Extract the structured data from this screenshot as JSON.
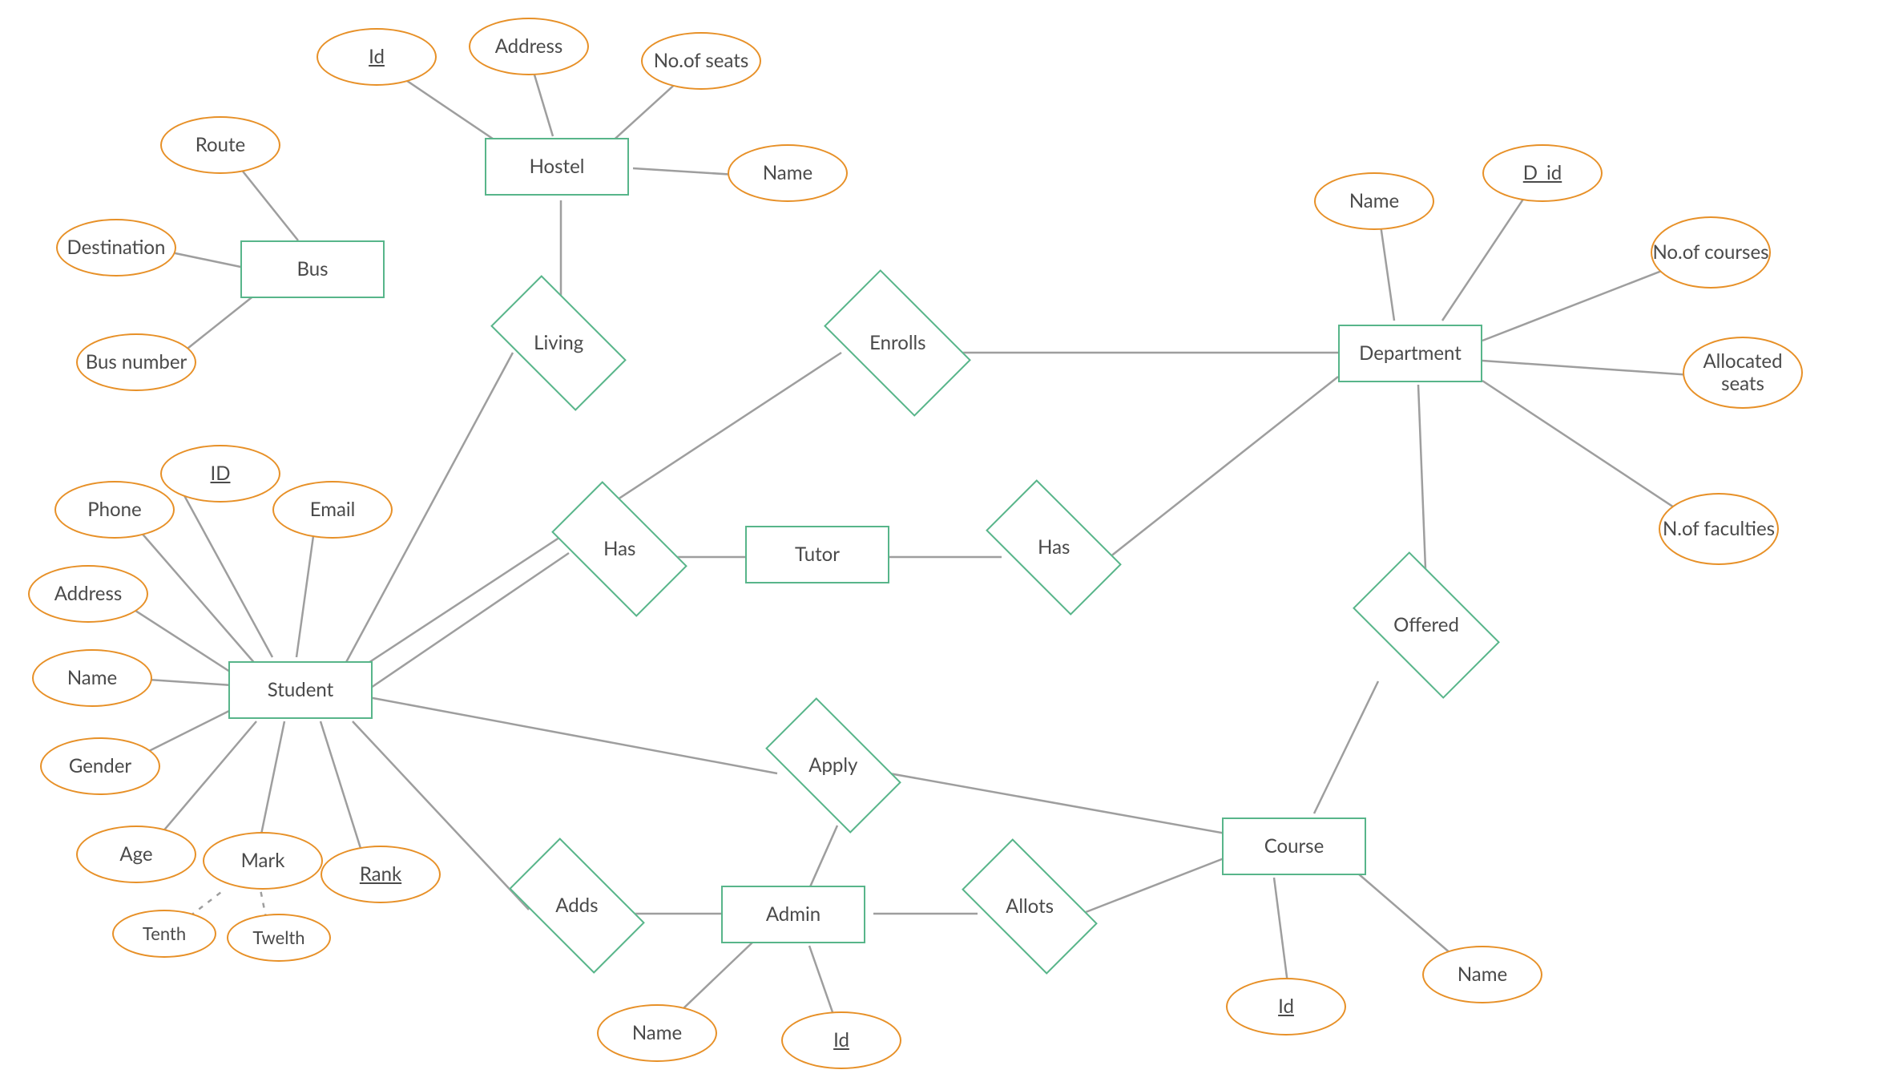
{
  "entities": {
    "hostel": "Hostel",
    "bus": "Bus",
    "student": "Student",
    "tutor": "Tutor",
    "department": "Department",
    "admin": "Admin",
    "course": "Course"
  },
  "relationships": {
    "living": "Living",
    "enrolls": "Enrolls",
    "has1": "Has",
    "has2": "Has",
    "apply": "Apply",
    "adds": "Adds",
    "allots": "Allots",
    "offered": "Offered"
  },
  "attributes": {
    "hostel_id": "Id",
    "hostel_address": "Address",
    "hostel_seats": "No.of seats",
    "hostel_name": "Name",
    "bus_route": "Route",
    "bus_destination": "Destination",
    "bus_number": "Bus number",
    "student_phone": "Phone",
    "student_id": "ID",
    "student_email": "Email",
    "student_address": "Address",
    "student_name": "Name",
    "student_gender": "Gender",
    "student_age": "Age",
    "student_mark": "Mark",
    "student_rank": "Rank",
    "student_tenth": "Tenth",
    "student_twelth": "Twelth",
    "dept_name": "Name",
    "dept_id": "D_id",
    "dept_nocourses": "No.of courses",
    "dept_allocseats": "Allocated seats",
    "dept_nofac": "N.of faculties",
    "admin_name": "Name",
    "admin_id": "Id",
    "course_id": "Id",
    "course_name": "Name"
  },
  "colors": {
    "entity_border": "#58b58a",
    "attribute_border": "#e79027",
    "line": "#9e9e9e",
    "text": "#4a4a4a"
  },
  "diagram_type": "ER Diagram",
  "notation": {
    "rectangle": "entity",
    "diamond": "relationship",
    "ellipse_orange": "attribute",
    "underline": "primary key",
    "dashed_line": "derived/sub-attribute link"
  }
}
